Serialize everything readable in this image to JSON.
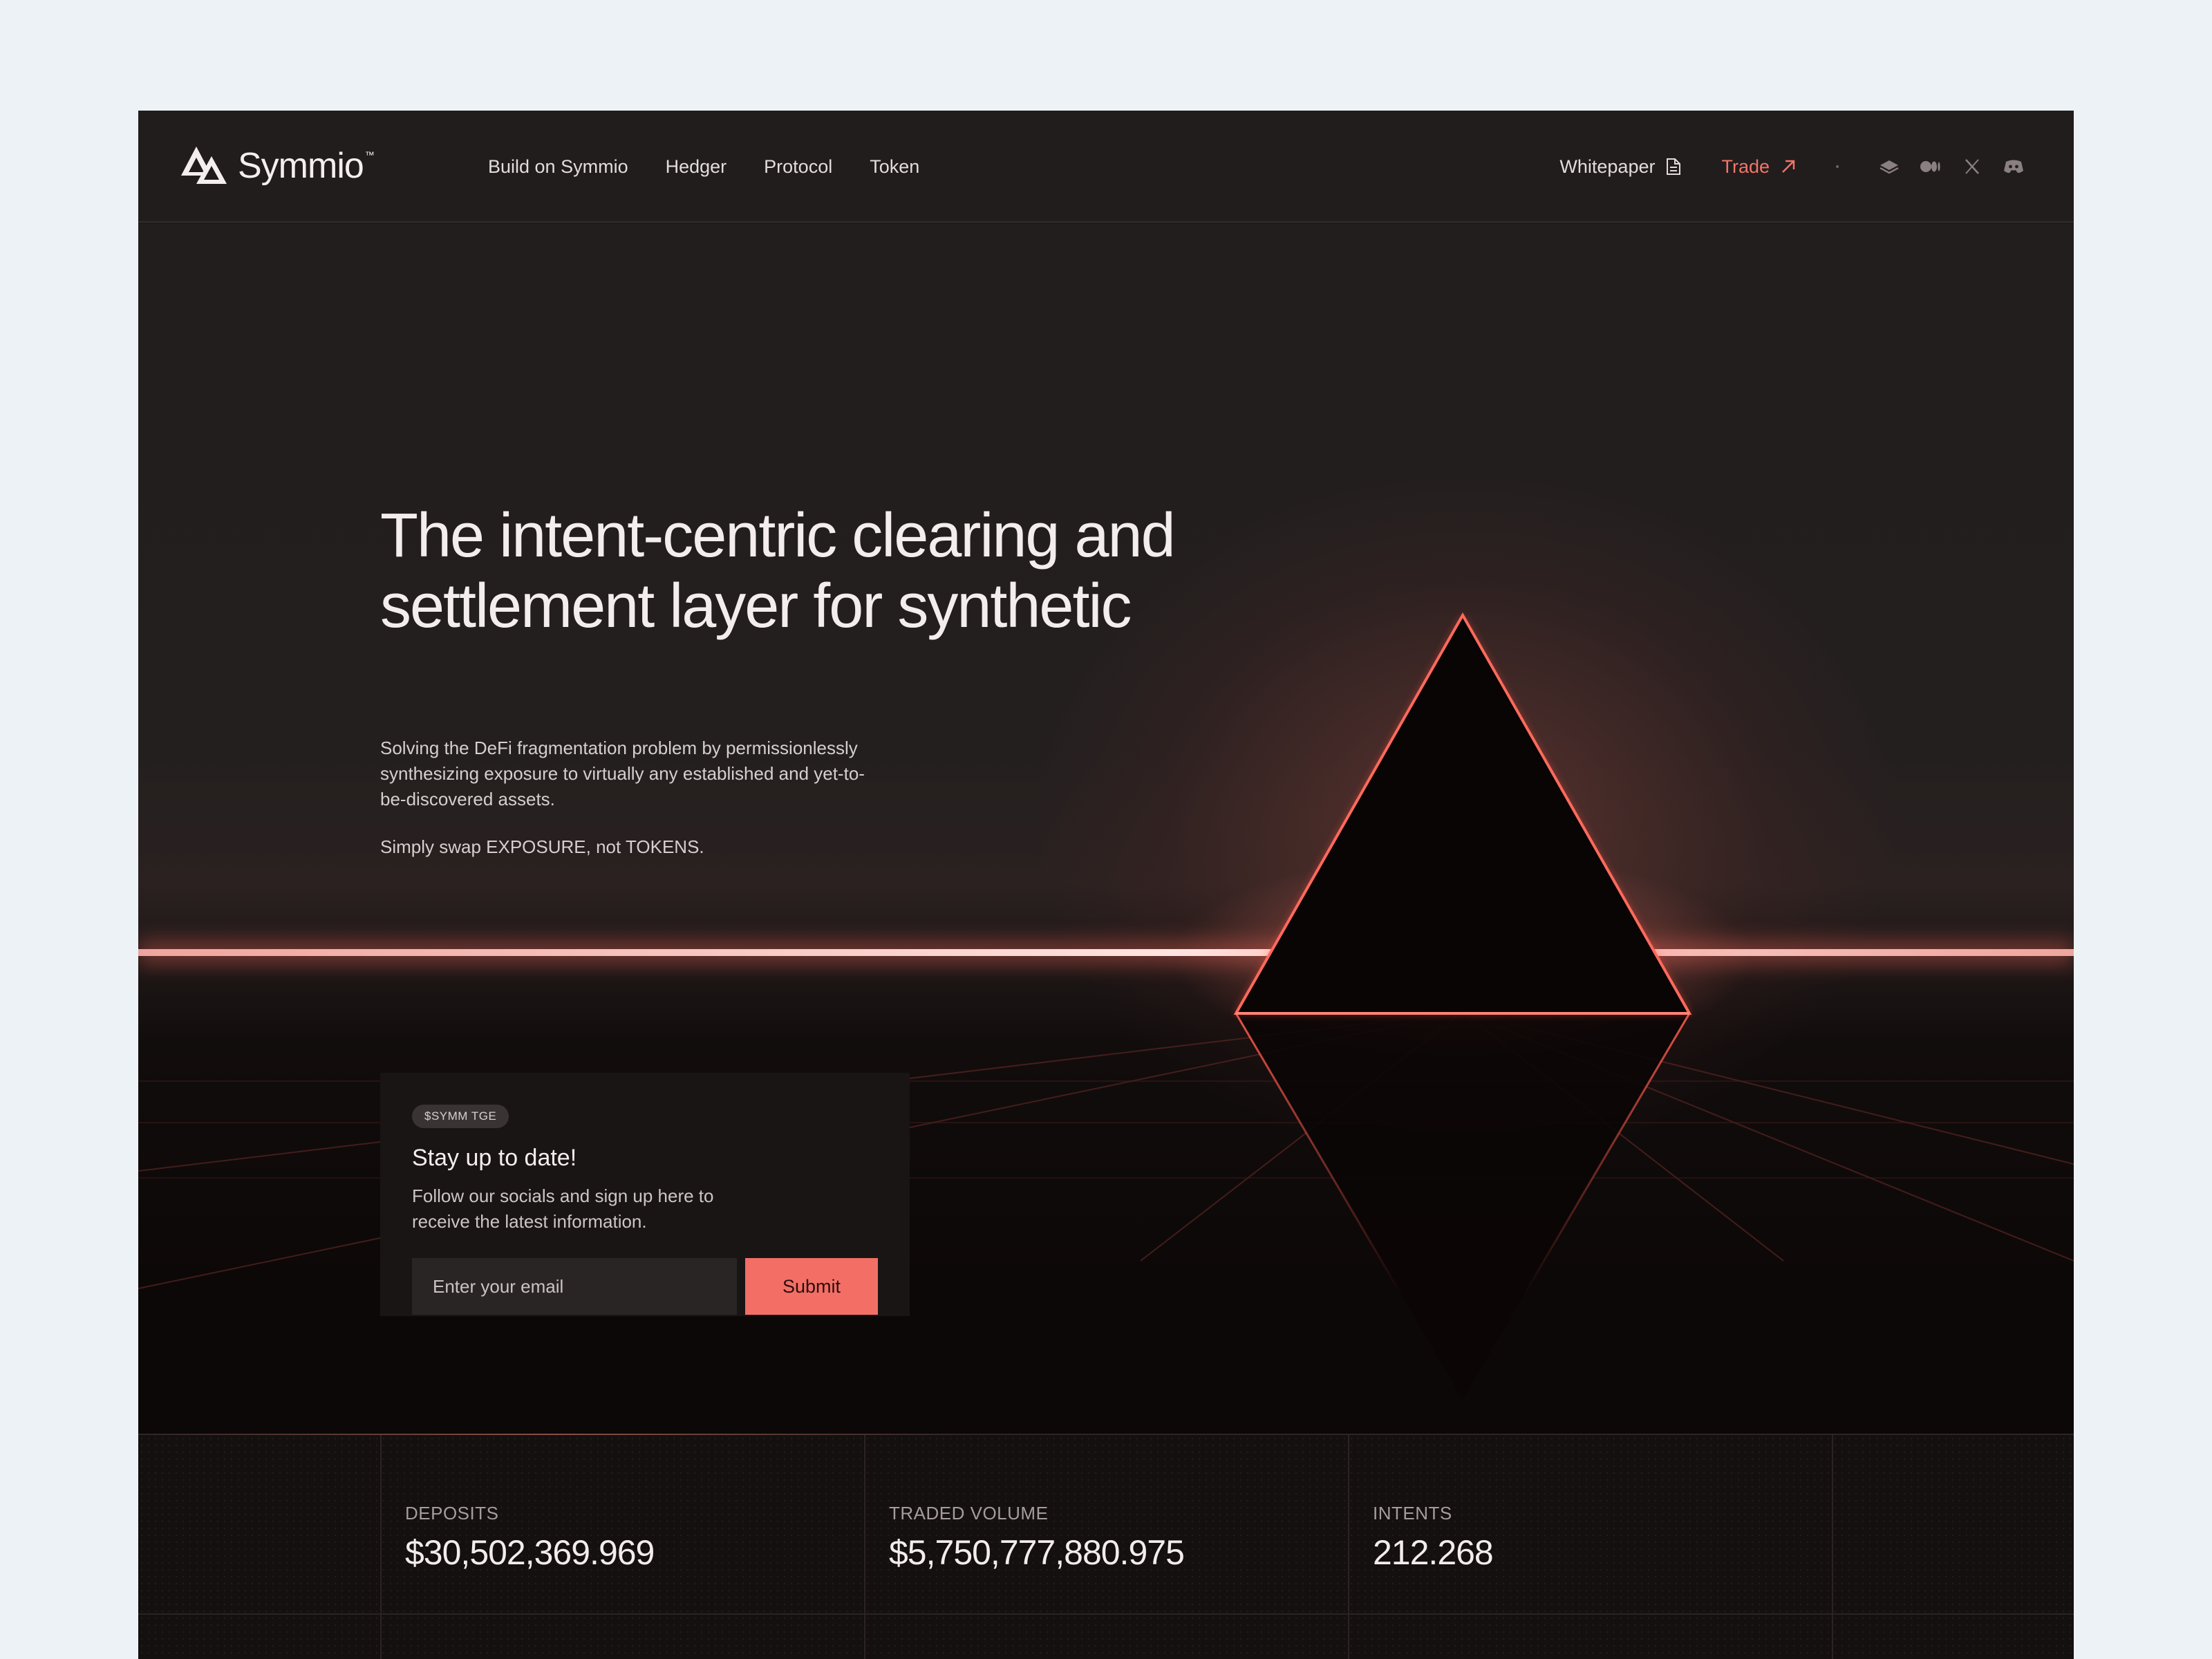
{
  "brand": {
    "name": "Symmio",
    "tm": "™"
  },
  "nav": {
    "links": [
      "Build on Symmio",
      "Hedger",
      "Protocol",
      "Token"
    ],
    "whitepaper": "Whitepaper",
    "trade": "Trade",
    "social_icons": [
      "gitbook-icon",
      "medium-icon",
      "x-icon",
      "discord-icon"
    ]
  },
  "hero": {
    "headline": "The intent-centric clearing and settlement layer for synthetic",
    "description": "Solving the DeFi fragmentation problem by permissionlessly synthesizing exposure to virtually any established and yet-to-be-discovered assets.",
    "tagline": "Simply swap EXPOSURE, not TOKENS."
  },
  "signup": {
    "badge": "$SYMM TGE",
    "title": "Stay up to date!",
    "text": "Follow our socials and sign up here to receive the latest information.",
    "email_placeholder": "Enter your email",
    "submit_label": "Submit"
  },
  "stats": [
    {
      "label": "DEPOSITS",
      "value": "$30,502,369.969"
    },
    {
      "label": "TRADED VOLUME",
      "value": "$5,750,777,880.975"
    },
    {
      "label": "INTENTS",
      "value": "212.268"
    }
  ],
  "colors": {
    "accent": "#f36f66",
    "trade": "#f47468",
    "background": "#1f1b1b",
    "page": "#ecf2f5"
  }
}
